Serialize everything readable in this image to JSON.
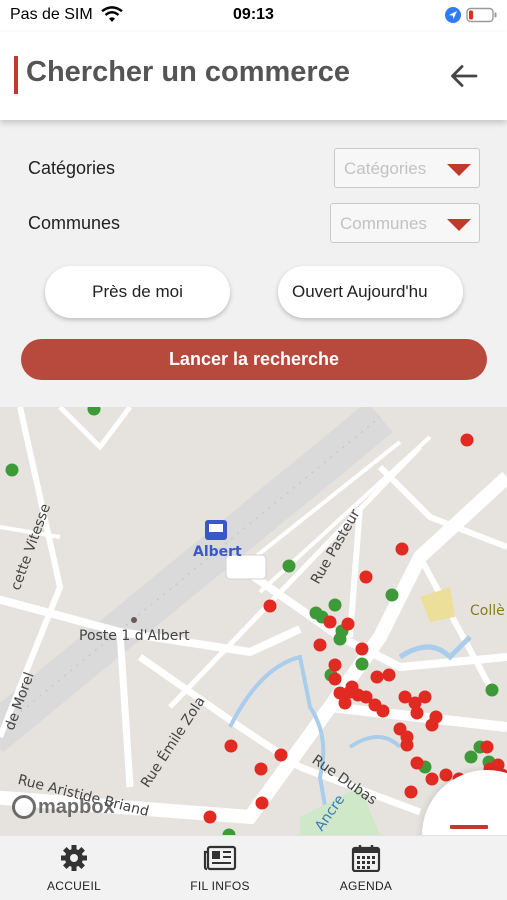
{
  "status_bar": {
    "carrier": "Pas de SIM",
    "time": "09:13",
    "icons": [
      "wifi-icon",
      "location-arrow-icon",
      "battery-icon"
    ]
  },
  "header": {
    "title": "Chercher un commerce",
    "accent_color": "#c0392b",
    "back_icon": "arrow-left-icon"
  },
  "filters": {
    "category_label": "Catégories",
    "category_placeholder": "Catégories",
    "commune_label": "Communes",
    "commune_placeholder": "Communes"
  },
  "quick_filters": {
    "near_me": "Près de moi",
    "open_today": "Ouvert Aujourd'hu"
  },
  "search_button": {
    "label": "Lancer la recherche",
    "color": "#b84a3d"
  },
  "map": {
    "labels": {
      "station": "Albert",
      "street_pasteur": "Rue Pasteur",
      "poste": "Poste 1 d'Albert",
      "street_zola": "Rue Émile Zola",
      "street_dubas": "Rue Dubas",
      "street_briand": "Rue Aristide Briand",
      "street_vitesse": "cette Vitesse",
      "street_morel": "de Morel",
      "river": "Ancre",
      "college": "Collè"
    },
    "attribution": "mapbox",
    "marker_colors": {
      "closed": "#e02a22",
      "open": "#3e9a38"
    }
  },
  "tab_bar": {
    "items": [
      {
        "label": "ACCUEIL",
        "icon": "gear-icon"
      },
      {
        "label": "FIL INFOS",
        "icon": "newspaper-icon"
      },
      {
        "label": "AGENDA",
        "icon": "calendar-icon"
      }
    ]
  },
  "menu_button": {
    "icon": "hamburger-menu-icon"
  }
}
